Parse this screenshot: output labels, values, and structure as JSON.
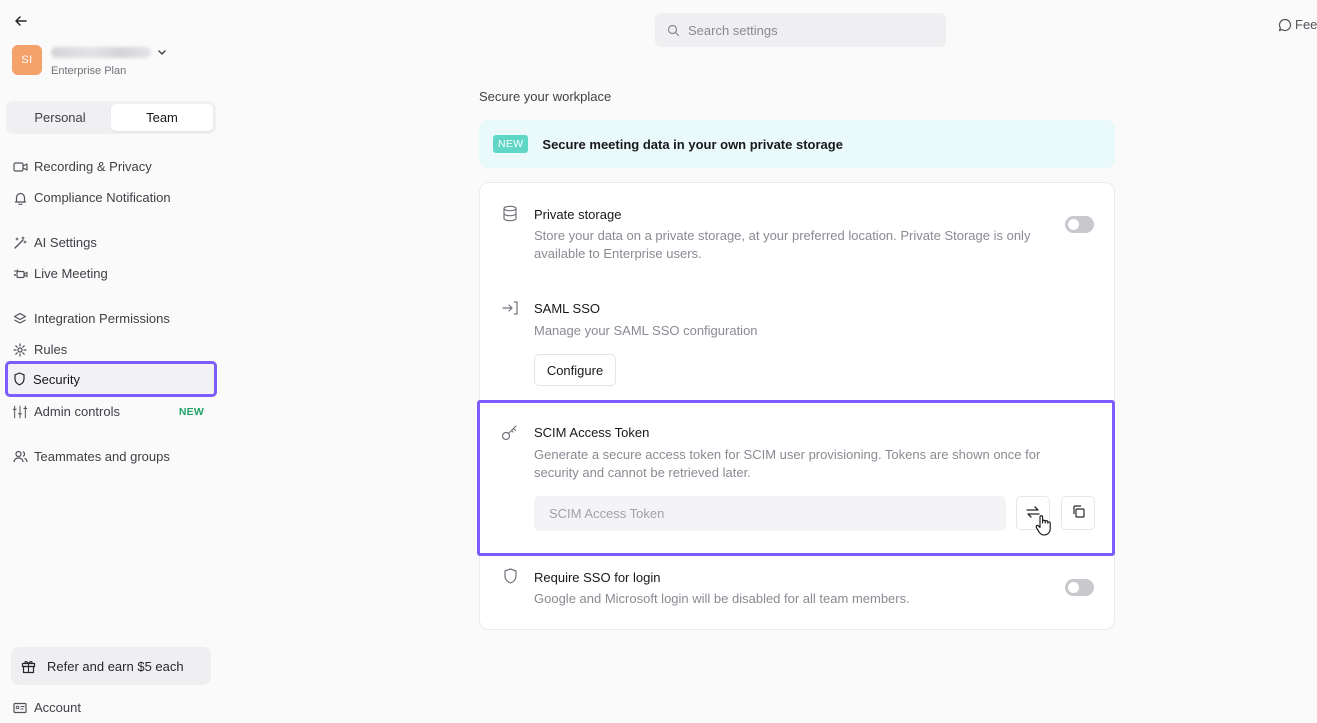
{
  "sidebar": {
    "account": {
      "initials": "SI",
      "plan": "Enterprise Plan"
    },
    "tabs": [
      {
        "label": "Personal",
        "active": false
      },
      {
        "label": "Team",
        "active": true
      }
    ],
    "items": [
      {
        "label": "Recording & Privacy",
        "icon": "video-icon"
      },
      {
        "label": "Compliance Notification",
        "icon": "bell-icon"
      },
      {
        "label": "AI Settings",
        "icon": "magic-wand-icon"
      },
      {
        "label": "Live Meeting",
        "icon": "live-camera-icon"
      },
      {
        "label": "Integration Permissions",
        "icon": "layers-icon"
      },
      {
        "label": "Rules",
        "icon": "rules-gear-icon"
      },
      {
        "label": "Security",
        "icon": "shield-icon",
        "selected": true
      },
      {
        "label": "Admin controls",
        "icon": "sliders-icon",
        "badge": "NEW"
      },
      {
        "label": "Teammates and groups",
        "icon": "users-icon"
      }
    ],
    "refer_label": "Refer and earn $5 each",
    "account_label": "Account"
  },
  "header": {
    "search_placeholder": "Search settings",
    "feedback_label": "Fee"
  },
  "main": {
    "section_title": "Secure your workplace",
    "banner": {
      "badge": "NEW",
      "text": "Secure meeting data in your own private storage"
    },
    "private_storage": {
      "title": "Private storage",
      "description_line1": "Store your data on a private storage, at your preferred location. Private Storage is only",
      "description_line2": "available to Enterprise users.",
      "enabled": false
    },
    "saml_sso": {
      "title": "SAML SSO",
      "description": "Manage your SAML SSO configuration",
      "configure_label": "Configure"
    },
    "scim": {
      "title": "SCIM Access Token",
      "description_line1": "Generate a secure access token for SCIM user provisioning. Tokens are shown once for",
      "description_line2": "security and cannot be retrieved later.",
      "token_placeholder": "SCIM Access Token",
      "token_value": ""
    },
    "require_sso": {
      "title": "Require SSO for login",
      "description": "Google and Microsoft login will be disabled for all team members.",
      "enabled": false
    }
  },
  "colors": {
    "highlight": "#7c5cfa",
    "new_badge_green": "#22a366",
    "banner_badge": "#5fd6c6",
    "avatar": "#f4a26a"
  }
}
